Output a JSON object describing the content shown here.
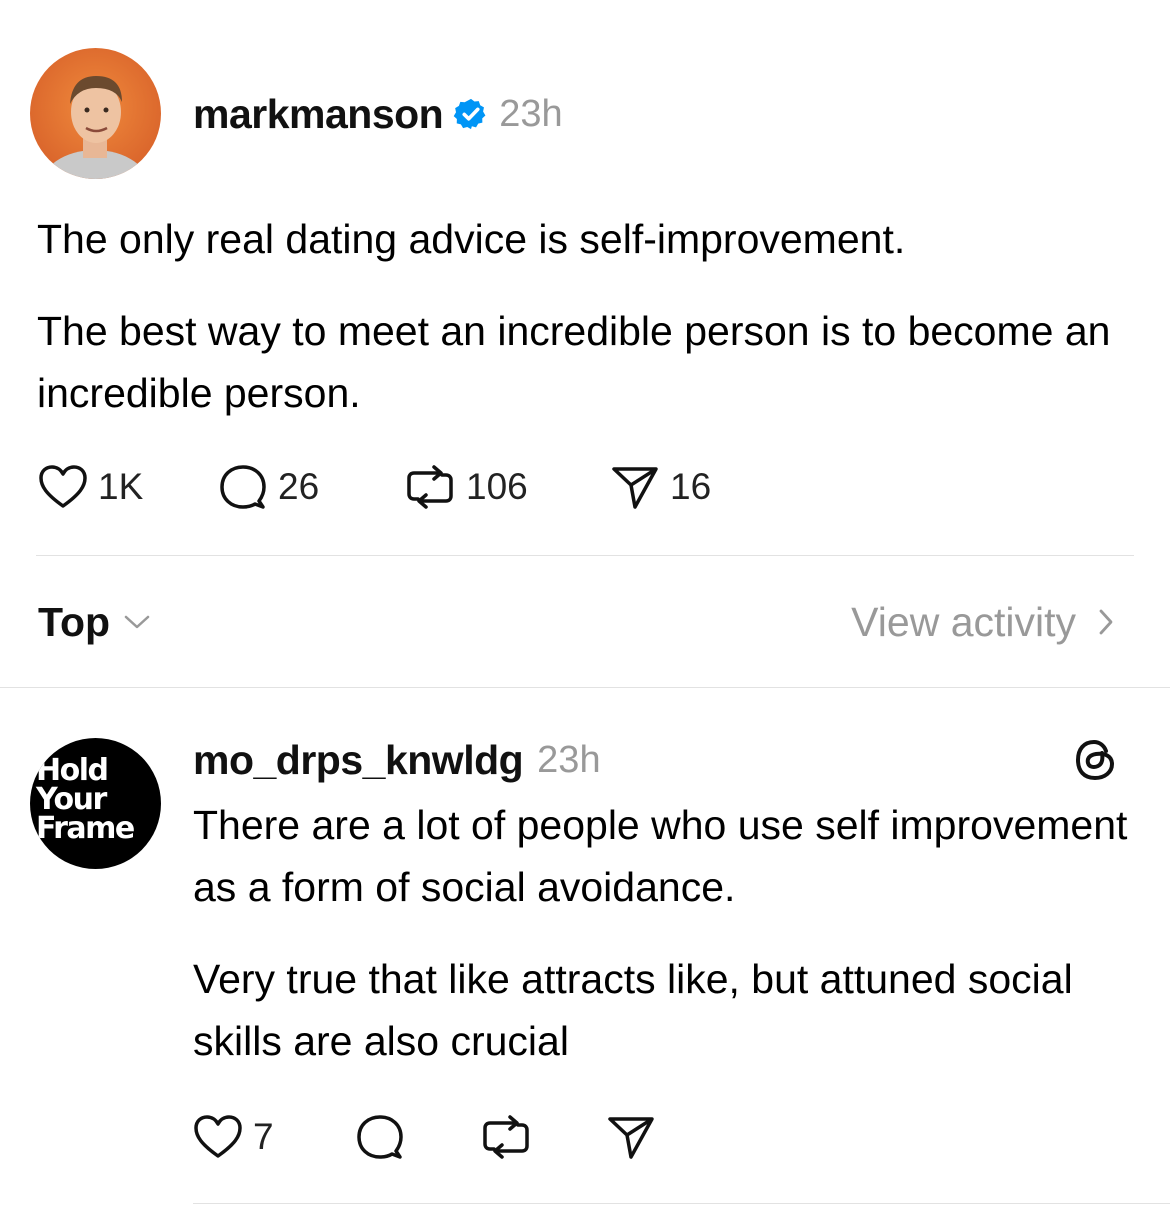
{
  "post": {
    "username": "markmanson",
    "verified_icon": "verified-badge-icon",
    "time": "23h",
    "paragraphs": [
      "The only real dating advice is self-improvement.",
      "The best way to meet an incredible person is to become an incredible person."
    ],
    "actions": {
      "likes": "1K",
      "comments": "26",
      "reposts": "106",
      "shares": "16"
    }
  },
  "sort": {
    "label": "Top",
    "view_activity": "View activity"
  },
  "reply": {
    "username": "mo_drps_knwldg",
    "time": "23h",
    "avatar_lines": [
      "Hold",
      "Your",
      "Frame"
    ],
    "paragraphs": [
      "There are a lot of people who use self improvement as a form of social avoidance.",
      "Very true that like attracts like, but attuned social skills are also crucial"
    ],
    "actions": {
      "likes": "7"
    },
    "app_icon": "threads-logo-icon"
  },
  "colors": {
    "verified": "#0095f6",
    "muted": "#999999",
    "divider": "#e2e2e2"
  }
}
